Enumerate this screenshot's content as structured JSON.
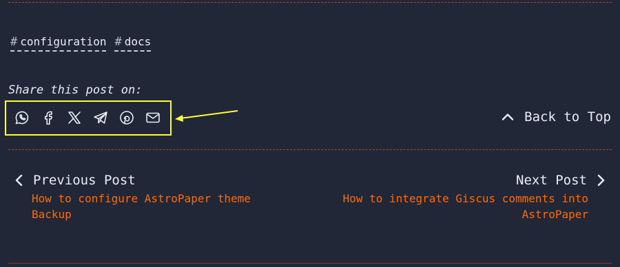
{
  "tags": [
    {
      "hash": "#",
      "label": "configuration"
    },
    {
      "hash": "#",
      "label": "docs"
    }
  ],
  "share": {
    "label": "Share this post on:",
    "icons": [
      "whatsapp-icon",
      "facebook-icon",
      "x-icon",
      "telegram-icon",
      "pinterest-icon",
      "mail-icon"
    ]
  },
  "back_to_top": {
    "label": "Back to Top",
    "icon": "chevron-up-icon"
  },
  "previous_post": {
    "heading": "Previous Post",
    "title_line1": "How to configure AstroPaper theme",
    "title_line2": "Backup"
  },
  "next_post": {
    "heading": "Next Post",
    "title_line1": "How to integrate Giscus comments into",
    "title_line2": "AstroPaper"
  },
  "colors": {
    "background": "#212737",
    "text": "#eaedf3",
    "accent": "#ff6b01",
    "divider": "#b24d22",
    "highlight": "#ffff33"
  }
}
